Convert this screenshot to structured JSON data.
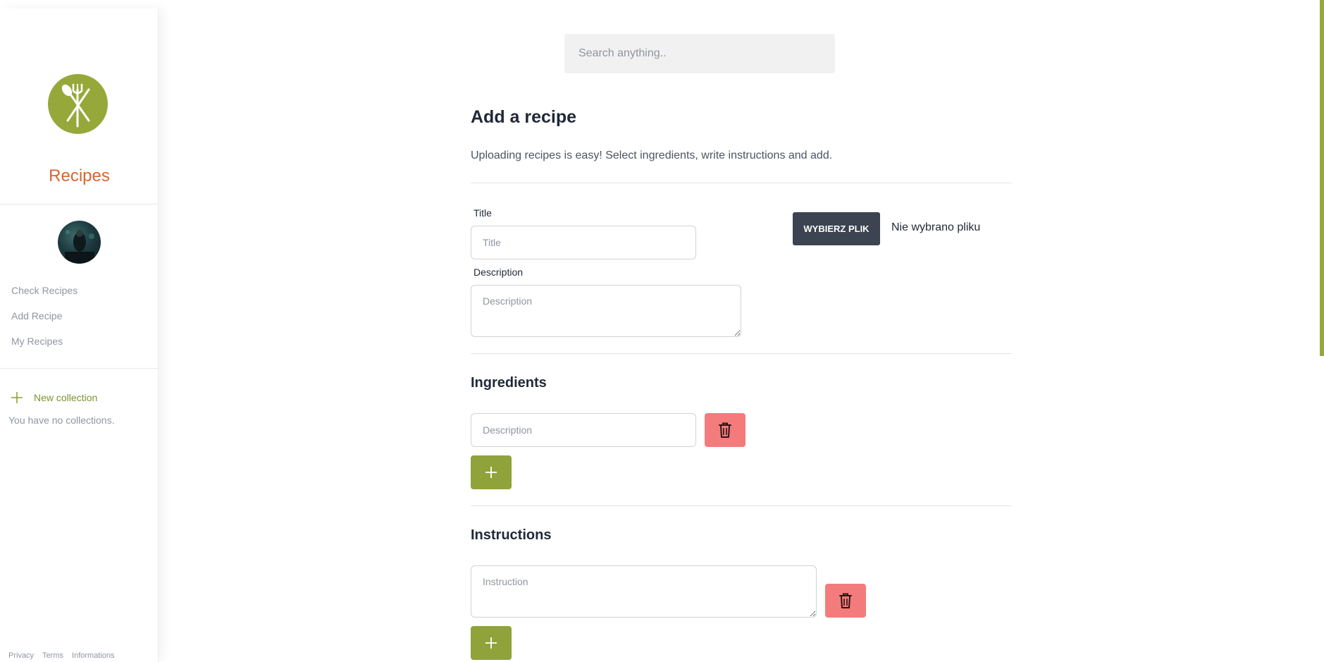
{
  "sidebar": {
    "brand": "Recipes",
    "logo_icon": "fork-spoon-knife-icon",
    "nav": [
      {
        "label": "Check Recipes"
      },
      {
        "label": "Add Recipe"
      },
      {
        "label": "My Recipes"
      }
    ],
    "new_collection_label": "New collection",
    "no_collections_text": "You have no collections.",
    "footer": [
      "Privacy",
      "Terms",
      "Informations"
    ]
  },
  "search": {
    "placeholder": "Search anything.."
  },
  "form": {
    "title": "Add a recipe",
    "subtitle": "Uploading recipes is easy! Select ingredients, write instructions and add.",
    "title_label": "Title",
    "title_placeholder": "Title",
    "description_label": "Description",
    "description_placeholder": "Description",
    "file_button_label": "WYBIERZ PLIK",
    "file_status": "Nie wybrano pliku",
    "ingredients_heading": "Ingredients",
    "ingredient_placeholder": "Description",
    "instructions_heading": "Instructions",
    "instruction_placeholder": "Instruction"
  },
  "colors": {
    "accent_green": "#97a83b",
    "brand_orange": "#d7652f",
    "delete_red": "#f47b7b",
    "file_button_dark": "#3b4450"
  }
}
